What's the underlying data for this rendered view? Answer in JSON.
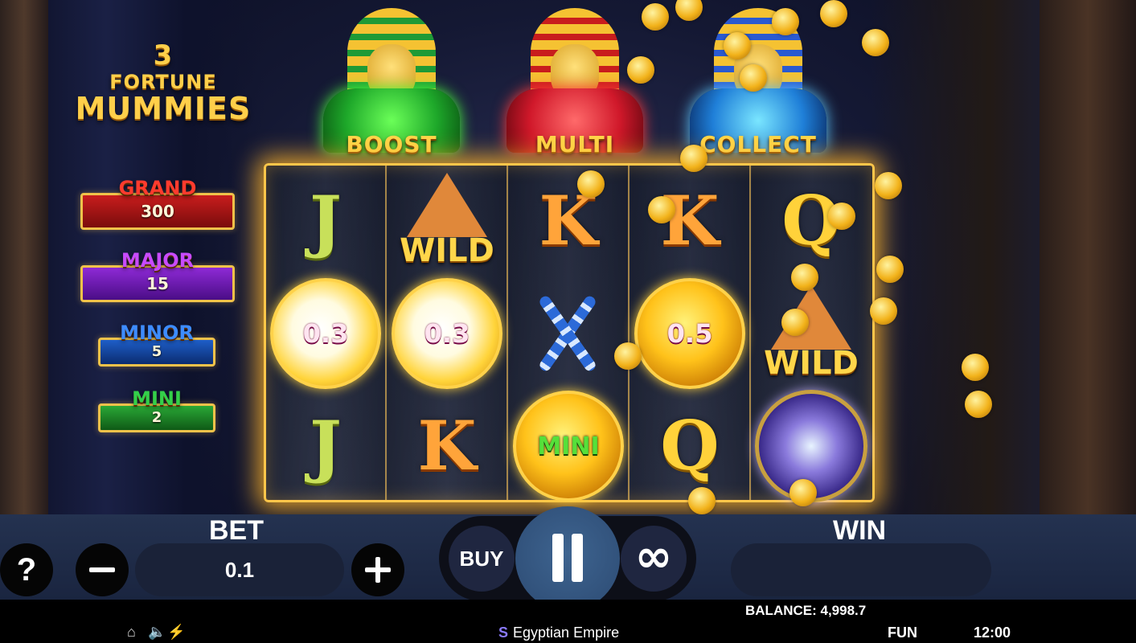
{
  "logo": {
    "line1": "3",
    "line2": "FORTUNE",
    "line3": "MUMMIES"
  },
  "jackpots": [
    {
      "name": "GRAND",
      "value": "300"
    },
    {
      "name": "MAJOR",
      "value": "15"
    },
    {
      "name": "MINOR",
      "value": "5"
    },
    {
      "name": "MINI",
      "value": "2"
    }
  ],
  "mummies": [
    {
      "label": "BOOST",
      "color": "#1f9a36"
    },
    {
      "label": "MULTI",
      "color": "#c81d1d"
    },
    {
      "label": "COLLECT",
      "color": "#2a5ad0"
    }
  ],
  "reels": {
    "reel1": [
      "J",
      "0.3",
      "J"
    ],
    "reel2": [
      "WILD",
      "0.3",
      "K"
    ],
    "reel3": [
      "K",
      "staff-icon",
      "MINI"
    ],
    "reel4": [
      "K",
      "0.5",
      "Q"
    ],
    "reel5": [
      "Q",
      "WILD",
      "portal-icon"
    ]
  },
  "controls": {
    "help": "?",
    "bet_label": "BET",
    "bet_value": "0.1",
    "buy": "BUY",
    "autoplay": "∞",
    "win_label": "WIN",
    "win_value": ""
  },
  "footer": {
    "balance": "BALANCE: 4,998.7",
    "game_name": "Egyptian Empire",
    "mode": "FUN",
    "time": "12:00",
    "icons": [
      "home-icon",
      "sound-icon",
      "turbo-icon"
    ]
  },
  "colors": {
    "reel_border": "#ffc64a",
    "grand": "#c81d1d",
    "major": "#8e2ad6",
    "minor": "#1e5ec8",
    "mini": "#2aa836"
  }
}
